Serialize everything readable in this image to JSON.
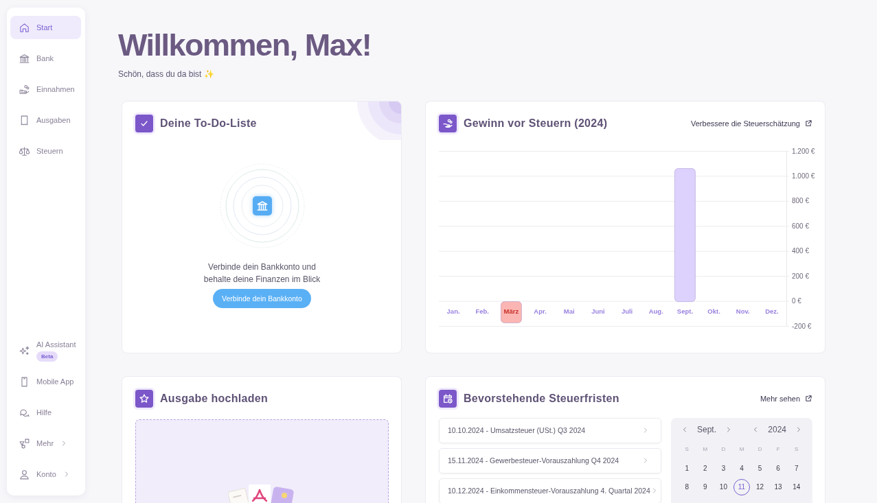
{
  "sidebar": {
    "items": [
      {
        "label": "Start",
        "selected": true
      },
      {
        "label": "Bank",
        "selected": false
      },
      {
        "label": "Einnahmen",
        "selected": false
      },
      {
        "label": "Ausgaben",
        "selected": false
      },
      {
        "label": "Steuern",
        "selected": false
      }
    ],
    "bottom_items": [
      {
        "label": "AI Assistant",
        "badge": "Beta",
        "selected": false,
        "expandable": false
      },
      {
        "label": "Mobile App",
        "selected": false,
        "expandable": false
      },
      {
        "label": "Hilfe",
        "selected": false,
        "expandable": false
      },
      {
        "label": "Mehr",
        "selected": false,
        "expandable": true
      },
      {
        "label": "Konto",
        "selected": false,
        "expandable": true
      }
    ]
  },
  "header": {
    "title": "Willkommen, Max!",
    "subtitle": "Schön, dass du da bist ✨"
  },
  "todo": {
    "title": "Deine To-Do-Liste",
    "message": "Verbinde dein Bankkonto und behalte deine Finanzen im Blick",
    "button": "Verbinde dein Bankkonto"
  },
  "profit": {
    "title": "Gewinn vor Steuern (2024)",
    "link": "Verbessere die Steuerschätzung",
    "chart_data": {
      "type": "bar",
      "categories": [
        "Jan.",
        "Feb.",
        "März",
        "Apr.",
        "Mai",
        "Juni",
        "Juli",
        "Aug.",
        "Sept.",
        "Okt.",
        "Nov.",
        "Dez."
      ],
      "series": [
        {
          "color": "#ddd2fd",
          "values": [
            null,
            null,
            null,
            null,
            null,
            null,
            null,
            null,
            1065,
            null,
            null,
            null
          ]
        },
        {
          "color": "#fbb6b3",
          "values": [
            null,
            null,
            -170,
            null,
            null,
            null,
            null,
            null,
            null,
            null,
            null,
            null
          ]
        }
      ],
      "grid": true,
      "ylim": [
        -200,
        1200
      ],
      "yticks": [
        {
          "value": 1200,
          "label": "1.200 €"
        },
        {
          "value": 1000,
          "label": "1.000 €"
        },
        {
          "value": 800,
          "label": "800 €"
        },
        {
          "value": 600,
          "label": "600 €"
        },
        {
          "value": 400,
          "label": "400 €"
        },
        {
          "value": 200,
          "label": "200 €"
        },
        {
          "value": 0,
          "label": "0 €"
        },
        {
          "value": -200,
          "label": "-200 €"
        }
      ]
    }
  },
  "upload": {
    "title": "Ausgabe hochladen"
  },
  "deadlines": {
    "title": "Bevorstehende Steuerfristen",
    "link": "Mehr sehen",
    "items": [
      "10.10.2024 - Umsatzsteuer (USt.) Q3 2024",
      "15.11.2024 - Gewerbesteuer-Vorauszahlung Q4 2024",
      "10.12.2024 - Einkommensteuer-Vorauszahlung 4. Quartal 2024"
    ],
    "calendar": {
      "month": "Sept.",
      "year": "2024",
      "weekdays": [
        "S",
        "M",
        "D",
        "M",
        "D",
        "F",
        "S"
      ],
      "days": [
        {
          "label": "1",
          "selected": false
        },
        {
          "label": "2",
          "selected": false
        },
        {
          "label": "3",
          "selected": false
        },
        {
          "label": "4",
          "selected": false
        },
        {
          "label": "5",
          "selected": false
        },
        {
          "label": "6",
          "selected": false
        },
        {
          "label": "7",
          "selected": false
        },
        {
          "label": "8",
          "selected": false
        },
        {
          "label": "9",
          "selected": false
        },
        {
          "label": "10",
          "selected": false
        },
        {
          "label": "11",
          "selected": true
        },
        {
          "label": "12",
          "selected": false
        },
        {
          "label": "13",
          "selected": false
        },
        {
          "label": "14",
          "selected": false
        }
      ]
    }
  }
}
